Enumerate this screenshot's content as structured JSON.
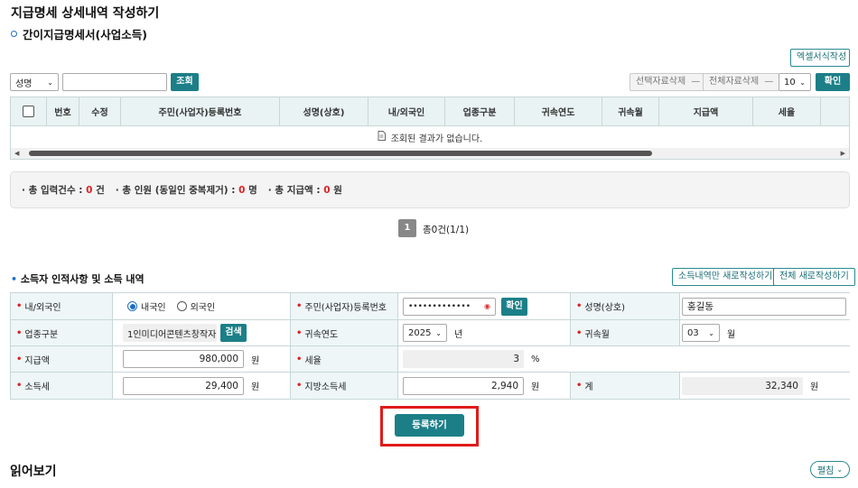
{
  "page_title": "지급명세 상세내역 작성하기",
  "section_title": "간이지급명세서(사업소득)",
  "excel_button": "엑셀서식작성",
  "search": {
    "field_select": "성명",
    "query_value": "",
    "search_button": "조회"
  },
  "toolbar": {
    "delete_selected": "선택자료삭제",
    "delete_all": "전체자료삭제",
    "page_size": "10",
    "confirm_button": "확인"
  },
  "grid": {
    "columns": [
      "번호",
      "수정",
      "주민(사업자)등록번호",
      "성명(상호)",
      "내/외국인",
      "업종구분",
      "귀속연도",
      "귀속월",
      "지급액",
      "세율"
    ],
    "empty_message": "조회된 결과가 없습니다."
  },
  "summary": {
    "entries_label": "총 입력건수 :",
    "entries_value": "0",
    "entries_unit": "건",
    "people_label": "총 인원 (동일인 중복제거) :",
    "people_value": "0",
    "people_unit": "명",
    "amount_label": "총 지급액 :",
    "amount_value": "0",
    "amount_unit": "원"
  },
  "pagination": {
    "current_page": "1",
    "total_text": "총0건(1/1)"
  },
  "income_section": {
    "title": "소득자 인적사항 및 소득 내역",
    "rewrite_income_button": "소득내역만 새로작성하기",
    "rewrite_all_button": "전체 새로작성하기"
  },
  "form": {
    "nationality_label": "내/외국인",
    "domestic_option": "내국인",
    "foreign_option": "외국인",
    "rrn_label": "주민(사업자)등록번호",
    "rrn_value": "•••••••••••••",
    "rrn_confirm_button": "확인",
    "name_label": "성명(상호)",
    "name_value": "홍길동",
    "industry_label": "업종구분",
    "industry_value": "1인미디어콘텐츠창작자",
    "industry_search_button": "검색",
    "year_label": "귀속연도",
    "year_value": "2025",
    "year_unit": "년",
    "month_label": "귀속월",
    "month_value": "03",
    "month_unit": "월",
    "payment_label": "지급액",
    "payment_value": "980,000",
    "payment_unit": "원",
    "tax_rate_label": "세율",
    "tax_rate_value": "3",
    "tax_rate_unit": "%",
    "income_tax_label": "소득세",
    "income_tax_value": "29,400",
    "income_tax_unit": "원",
    "local_tax_label": "지방소득세",
    "local_tax_value": "2,940",
    "local_tax_unit": "원",
    "total_label": "계",
    "total_value": "32,340",
    "total_unit": "원"
  },
  "register_button": "등록하기",
  "read_title": "읽어보기",
  "fold_button": "펼침"
}
